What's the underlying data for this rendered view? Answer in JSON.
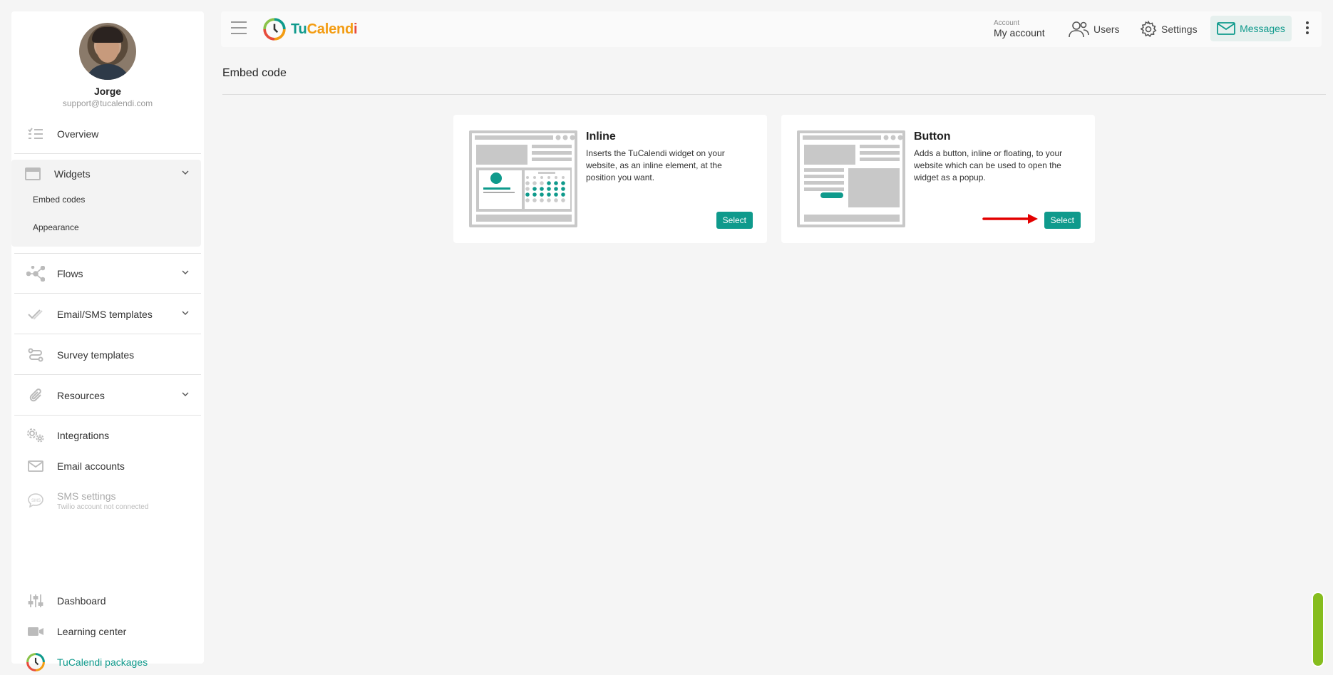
{
  "profile": {
    "name": "Jorge",
    "email": "support@tucalendi.com"
  },
  "sidebar": {
    "overview": "Overview",
    "widgets": "Widgets",
    "widgets_sub": [
      "Embed codes",
      "Appearance"
    ],
    "flows": "Flows",
    "email_sms_templates": "Email/SMS templates",
    "survey_templates": "Survey templates",
    "resources": "Resources",
    "integrations": "Integrations",
    "email_accounts": "Email accounts",
    "sms_settings": "SMS settings",
    "sms_sub": "Twilio account not connected",
    "dashboard": "Dashboard",
    "learning_center": "Learning center",
    "packages": "TuCalendi packages"
  },
  "header": {
    "logo_part1": "Tu",
    "logo_part2": "Calend",
    "logo_part3": "i",
    "account_small": "Account",
    "account_big": "My account",
    "users": "Users",
    "settings": "Settings",
    "messages": "Messages"
  },
  "main": {
    "title": "Embed code",
    "cards": [
      {
        "title": "Inline",
        "desc": "Inserts the TuCalendi widget on your website, as an inline element, at the position you want.",
        "button": "Select"
      },
      {
        "title": "Button",
        "desc": "Adds a button, inline or floating, to your website which can be used to open the widget as a popup.",
        "button": "Select"
      }
    ]
  },
  "colors": {
    "accent": "#0f9a8c",
    "logo_orange": "#f39c12",
    "arrow": "#e30000",
    "scroll": "#86bd1e"
  }
}
